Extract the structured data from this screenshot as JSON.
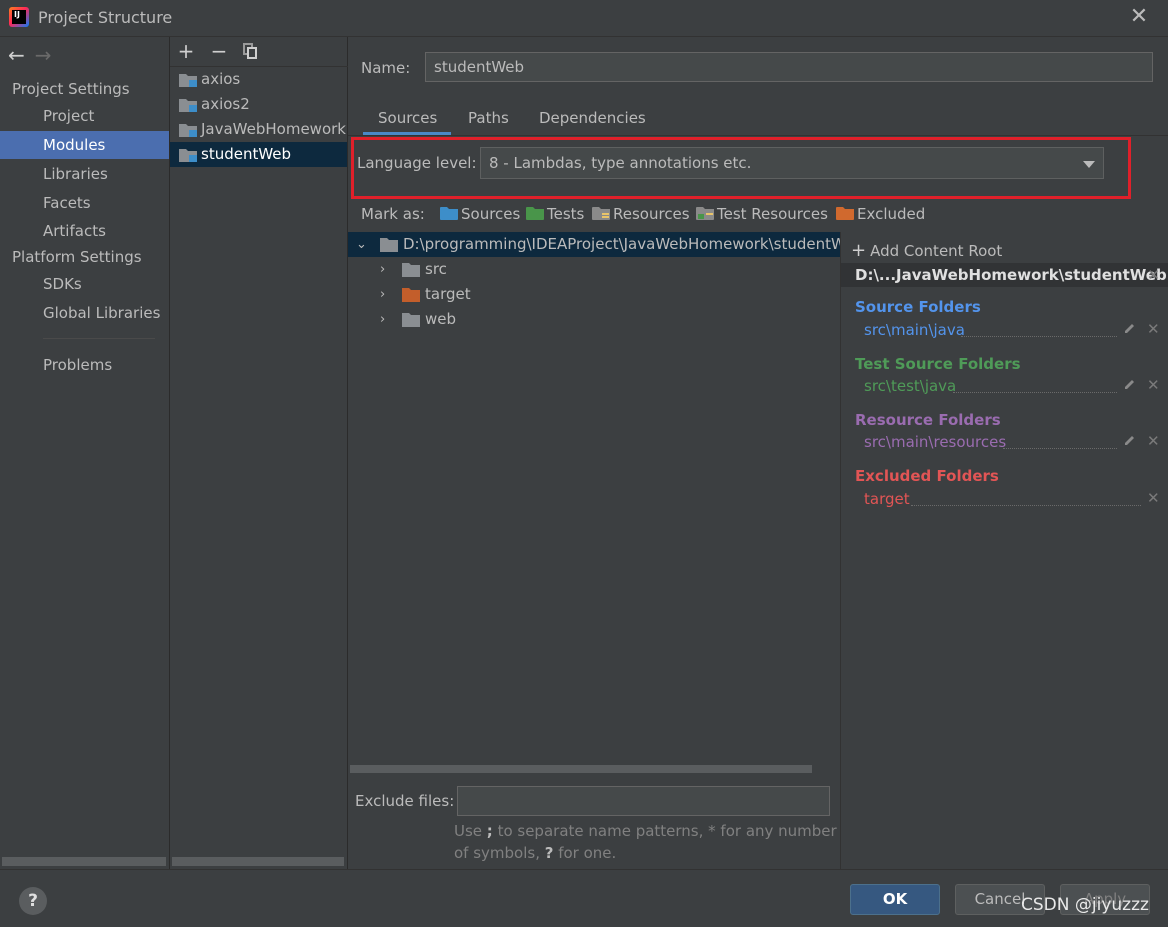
{
  "window": {
    "title": "Project Structure",
    "close_glyph": "✕",
    "app_icon_text": "IJ"
  },
  "nav": {
    "back_glyph": "←",
    "forward_glyph": "→",
    "project_settings_heading": "Project Settings",
    "project_settings_items": [
      "Project",
      "Modules",
      "Libraries",
      "Facets",
      "Artifacts"
    ],
    "platform_settings_heading": "Platform Settings",
    "platform_settings_items": [
      "SDKs",
      "Global Libraries"
    ],
    "problems_label": "Problems",
    "selected": "Modules"
  },
  "modules": {
    "toolbar": {
      "add_glyph": "+",
      "remove_glyph": "−"
    },
    "items": [
      "axios",
      "axios2",
      "JavaWebHomework",
      "studentWeb"
    ],
    "selected": "studentWeb"
  },
  "module_detail": {
    "name_label": "Name:",
    "name_value": "studentWeb",
    "tabs": [
      "Sources",
      "Paths",
      "Dependencies"
    ],
    "active_tab": "Sources",
    "language_level_label": "Language level:",
    "language_level_value": "8 - Lambdas, type annotations etc.",
    "mark_as_label": "Mark as:",
    "mark_as_options": [
      {
        "label": "Sources",
        "color": "#3d8ec9"
      },
      {
        "label": "Tests",
        "color": "#49954a"
      },
      {
        "label": "Resources",
        "color": "#8a8a8a"
      },
      {
        "label": "Test Resources",
        "color": "#8a8a8a"
      },
      {
        "label": "Excluded",
        "color": "#d0692e"
      }
    ],
    "tree": {
      "root": "D:\\programming\\IDEAProject\\JavaWebHomework\\studentWeb",
      "children": [
        {
          "label": "src",
          "color": "#8a8e92"
        },
        {
          "label": "target",
          "color": "#c35e2b"
        },
        {
          "label": "web",
          "color": "#8a8e92"
        }
      ]
    },
    "exclude_files_label": "Exclude files:",
    "exclude_files_value": "",
    "hint_line1_pre": "Use ",
    "hint_line1_sym": ";",
    "hint_line1_post": " to separate name patterns, * for any number",
    "hint_line2_pre": "of symbols, ",
    "hint_line2_sym": "?",
    "hint_line2_post": " for one."
  },
  "content_roots": {
    "add_label": "Add Content Root",
    "root_path": "D:\\...JavaWebHomework\\studentWeb",
    "remove_glyph": "✕",
    "sections": [
      {
        "heading": "Source Folders",
        "color": "#5394ec",
        "entry": "src\\main\\java",
        "entry_color": "#5394ec"
      },
      {
        "heading": "Test Source Folders",
        "color": "#4f9b58",
        "entry": "src\\test\\java",
        "entry_color": "#4f9b58"
      },
      {
        "heading": "Resource Folders",
        "color": "#9a6cb0",
        "entry": "src\\main\\resources",
        "entry_color": "#9a6cb0"
      },
      {
        "heading": "Excluded Folders",
        "color": "#e25555",
        "entry": "target",
        "entry_color": "#e25555"
      }
    ]
  },
  "footer": {
    "help_glyph": "?",
    "ok_label": "OK",
    "cancel_label": "Cancel",
    "apply_label": "Apply",
    "watermark": "CSDN @jiyuzzz"
  },
  "colors": {
    "background": "#3c3f41",
    "selection": "#4b6eaf",
    "tree_selection": "#0d293e",
    "highlight_box": "#e0202a",
    "tab_underline": "#4a88c7"
  }
}
